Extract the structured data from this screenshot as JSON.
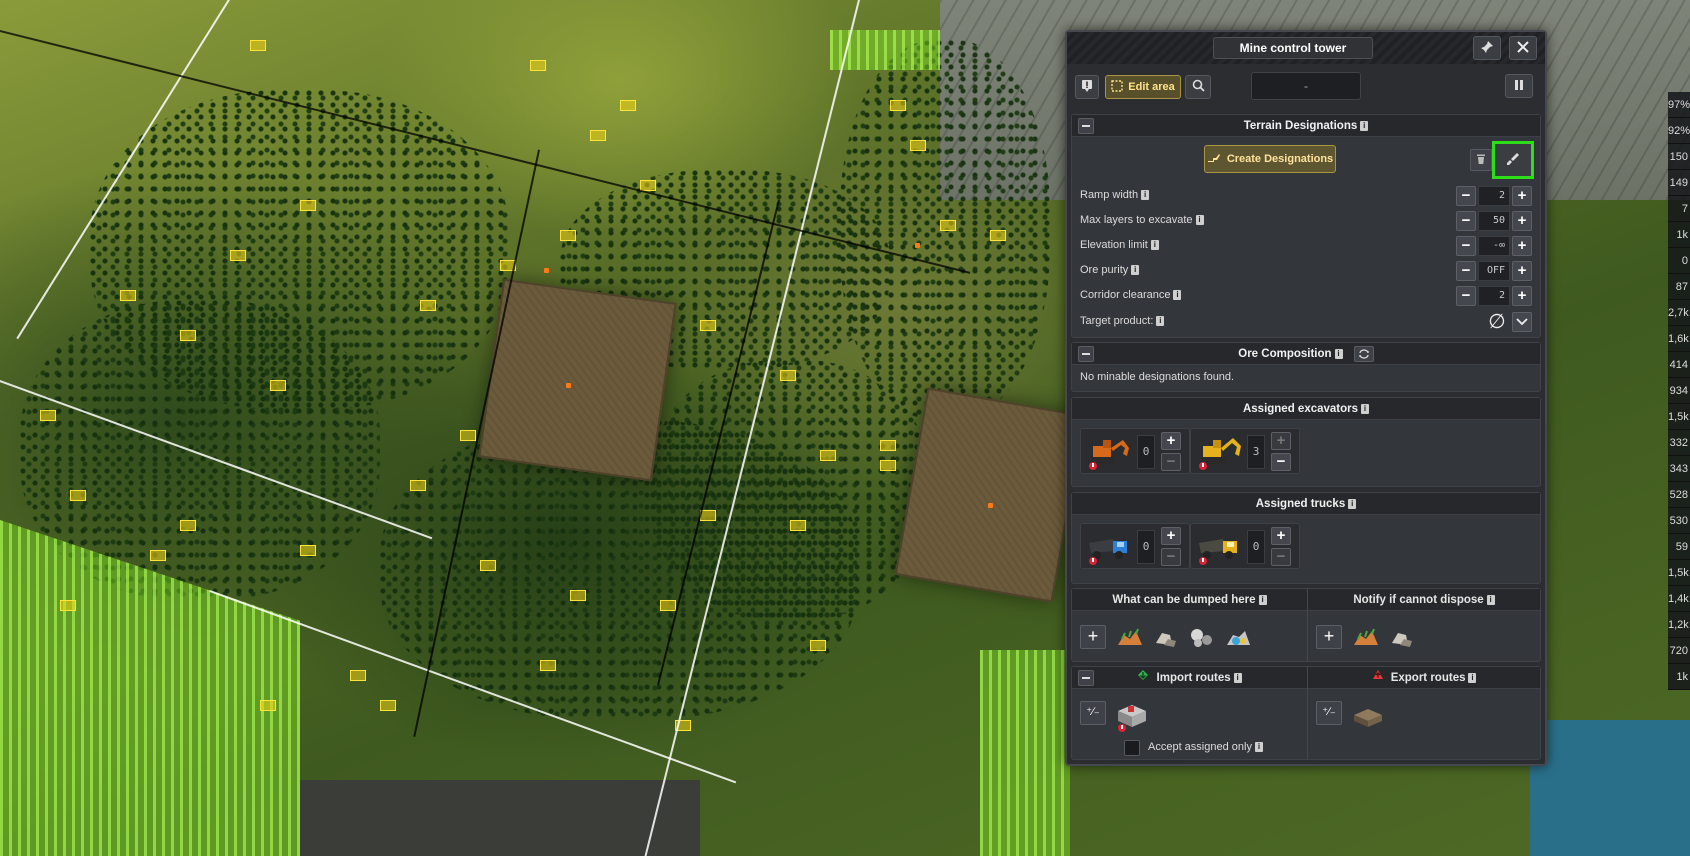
{
  "panel": {
    "title": "Mine control tower",
    "toolbar": {
      "edit_area_label": "Edit area",
      "dash_value": "-"
    },
    "terrain": {
      "header": "Terrain Designations",
      "create_label": "Create Designations",
      "rows": [
        {
          "label": "Ramp width",
          "value": "2"
        },
        {
          "label": "Max layers to excavate",
          "value": "50"
        },
        {
          "label": "Elevation limit",
          "value": "-∞"
        },
        {
          "label": "Ore purity",
          "value": "OFF"
        },
        {
          "label": "Corridor clearance",
          "value": "2"
        }
      ],
      "target_product_label": "Target product:",
      "target_product_value": "∅"
    },
    "ore": {
      "header": "Ore Composition",
      "empty_text": "No minable designations found."
    },
    "excavators": {
      "header": "Assigned excavators",
      "items": [
        {
          "icon": "orange-excavator-icon",
          "count": "0"
        },
        {
          "icon": "yellow-excavator-icon",
          "count": "3"
        }
      ]
    },
    "trucks": {
      "header": "Assigned trucks",
      "items": [
        {
          "icon": "blue-truck-icon",
          "count": "0"
        },
        {
          "icon": "yellow-truck-icon",
          "count": "0"
        }
      ]
    },
    "dumping": {
      "header_left": "What can be dumped here",
      "header_right": "Notify if cannot dispose"
    },
    "routes": {
      "import_label": "Import routes",
      "export_label": "Export routes",
      "accept_label": "Accept assigned only"
    }
  },
  "side_stats": [
    "97%",
    "92%",
    "150",
    "149",
    "7",
    "1k",
    "0",
    "87",
    "2,7k",
    "1,6k",
    "414",
    "934",
    "1,5k",
    "332",
    "343",
    "528",
    "530",
    "59",
    "1,5k",
    "1,4k",
    "1,2k",
    "720",
    "1k"
  ],
  "colors": {
    "highlight": "#2ede1a",
    "accent_gold": "#a9973f",
    "panel_bg": "#2b2d31"
  }
}
